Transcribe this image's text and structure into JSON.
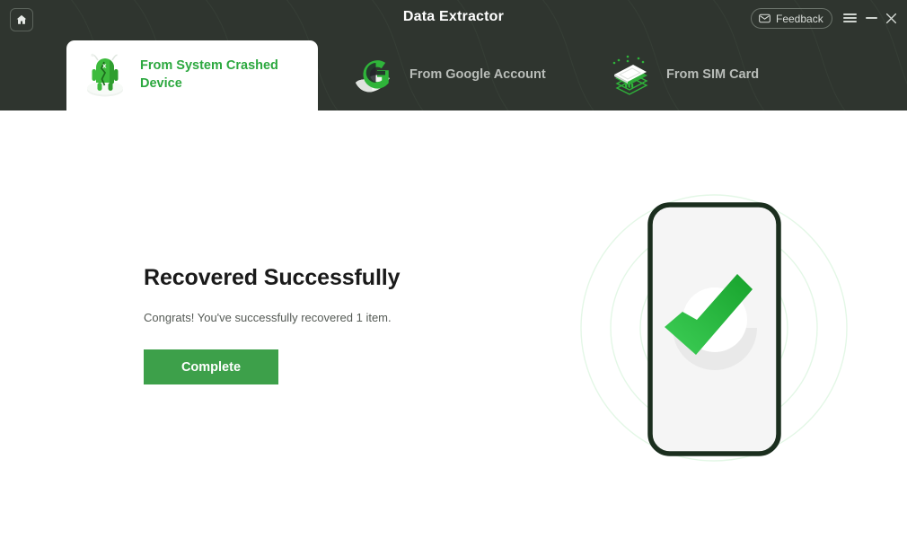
{
  "window": {
    "title": "Data Extractor",
    "home_icon": "home-icon",
    "feedback_label": "Feedback",
    "feedback_icon": "envelope-icon",
    "menu_icon": "hamburger-menu-icon",
    "minimize_icon": "minimize-icon",
    "close_icon": "close-icon"
  },
  "tabs": [
    {
      "label": "From System Crashed Device",
      "icon": "broken-android-icon",
      "active": true
    },
    {
      "label": "From Google Account",
      "icon": "google-account-icon",
      "active": false
    },
    {
      "label": "From SIM Card",
      "icon": "sim-card-icon",
      "active": false
    }
  ],
  "main": {
    "headline": "Recovered Successfully",
    "subtext": "Congrats! You've successfully recovered 1 item.",
    "complete_label": "Complete",
    "illustration_icon": "phone-success-checkmark-illustration"
  },
  "colors": {
    "header_bg": "#2f352f",
    "accent_green": "#3da04a",
    "tab_active_text": "#2ca83f",
    "tab_inactive_text": "#b9bdb9",
    "button_bg": "#3da04a",
    "phone_outline": "#1b2e1e",
    "ripple": "#e3f7e6"
  }
}
